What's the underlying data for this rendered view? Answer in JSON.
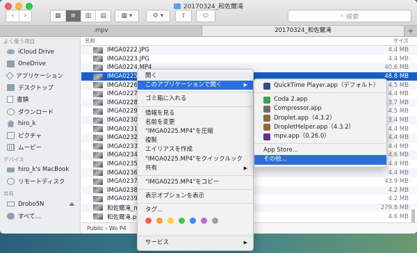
{
  "window": {
    "title": "20170324_和佐爾滝"
  },
  "toolbar": {
    "search_placeholder": "検索",
    "back_label": "‹",
    "forward_label": "›",
    "view_icons_glyph": "▦",
    "view_list_glyph": "≡",
    "view_columns_glyph": "▥",
    "view_coverflow_glyph": "▤",
    "arrange_glyph": "▦ ▾",
    "action_glyph": "⚙ ▾",
    "share_glyph": "⇪",
    "tag_glyph": "⬭"
  },
  "tabs": [
    {
      "label": ".mpv"
    },
    {
      "label": "20170324_和佐爾滝"
    }
  ],
  "tab_add_label": "+",
  "sidebar": {
    "favorites_header": "よく使う項目",
    "favorites": [
      {
        "label": "iCloud Drive",
        "icon": "cloud-icon"
      },
      {
        "label": "OneDrive",
        "icon": "folder-icon"
      },
      {
        "label": "アプリケーション",
        "icon": "applications-icon"
      },
      {
        "label": "デスクトップ",
        "icon": "desktop-icon"
      },
      {
        "label": "書類",
        "icon": "documents-icon"
      },
      {
        "label": "ダウンロード",
        "icon": "downloads-icon"
      },
      {
        "label": "hiro_k",
        "icon": "home-icon"
      },
      {
        "label": "ピクチャ",
        "icon": "pictures-icon"
      },
      {
        "label": "ムービー",
        "icon": "movies-icon"
      }
    ],
    "devices_header": "デバイス",
    "devices": [
      {
        "label": "hiro_k's MacBook",
        "icon": "laptop-icon"
      },
      {
        "label": "リモートディスク",
        "icon": "remote-disc-icon"
      }
    ],
    "shared_header": "共有",
    "shared": [
      {
        "label": "Drobo5N",
        "icon": "network-drive-icon",
        "eject": "⏏"
      },
      {
        "label": "すべて…",
        "icon": "globe-icon"
      }
    ]
  },
  "list": {
    "col_name": "名前",
    "col_size": "サイズ",
    "rows": [
      {
        "name": "IMGA0222.JPG",
        "size": "4.4 MB"
      },
      {
        "name": "IMGA0223.JPG",
        "size": "4.4 MB"
      },
      {
        "name": "IMGA0224.MP4",
        "size": "40.6 MB"
      },
      {
        "name": "IMGA0225.MP4",
        "size": "48.8 MB",
        "selected": true
      },
      {
        "name": "IMGA0226.",
        "size": "4.5 MB"
      },
      {
        "name": "IMGA0227.JI",
        "size": "4.4 MB"
      },
      {
        "name": "IMGA0228.M",
        "size": "3.7 MB"
      },
      {
        "name": "IMGA0229.JI",
        "size": "4.5 MB"
      },
      {
        "name": "IMGA0230.M",
        "size": "3.4 MB"
      },
      {
        "name": "IMGA0231.JI",
        "size": "4.4 MB"
      },
      {
        "name": "IMGA0232.JI",
        "size": "4.4 MB"
      },
      {
        "name": "IMGA0233.JI",
        "size": "4.4 MB"
      },
      {
        "name": "IMGA0234.JI",
        "size": "4.6 MB"
      },
      {
        "name": "IMGA0235.JI",
        "size": "4.4 MB"
      },
      {
        "name": "IMGA0236.JI",
        "size": "4.4 MB"
      },
      {
        "name": "IMGA0237.M",
        "size": "43.9 MB"
      },
      {
        "name": "IMGA0238.JI",
        "size": "4.2 MB"
      },
      {
        "name": "IMGA0239.JI",
        "size": "4.2 MB"
      },
      {
        "name": "和佐爾滝_map",
        "size": "279.8 MB"
      },
      {
        "name": "和佐爾滝.prpr",
        "size": "4.6 MB"
      }
    ]
  },
  "pathbar": {
    "text": "Public  ›  Wo                                                                         P4"
  },
  "context_menu": {
    "items": {
      "open": "開く",
      "open_with": "このアプリケーションで開く",
      "trash": "ゴミ箱に入れる",
      "get_info": "情報を見る",
      "rename": "名前を変更",
      "compress": "\"IMGA0225.MP4\"を圧縮",
      "duplicate": "複製",
      "make_alias": "エイリアスを作成",
      "quick_look": "\"IMGA0225.MP4\"をクイックルック",
      "share": "共有",
      "copy": "\"IMGA0225.MP4\"をコピー",
      "view_options": "表示オプションを表示",
      "tags": "タグ...",
      "services": "サービス"
    },
    "arrow": "▶",
    "tag_colors": [
      "#ff5b52",
      "#ff9f2e",
      "#ffd43b",
      "#44c553",
      "#3b8cf2",
      "#b66dd9",
      "#a0a0a0"
    ]
  },
  "submenu": {
    "apps": [
      {
        "label": "QuickTime Player.app（デフォルト）",
        "color": "#2a4f8a"
      },
      {
        "label": "Coda 2.app",
        "color": "#3fa34d"
      },
      {
        "label": "Compressor.app",
        "color": "#6d6d6d"
      },
      {
        "label": "Droplet.app（4.3.2）",
        "color": "#8a6d3b"
      },
      {
        "label": "DropletHelper.app（4.3.2）",
        "color": "#8a6d3b"
      },
      {
        "label": "mpv.app（0.26.0）",
        "color": "#6a2e8f"
      }
    ],
    "app_store": "App Store...",
    "other": "その他..."
  }
}
